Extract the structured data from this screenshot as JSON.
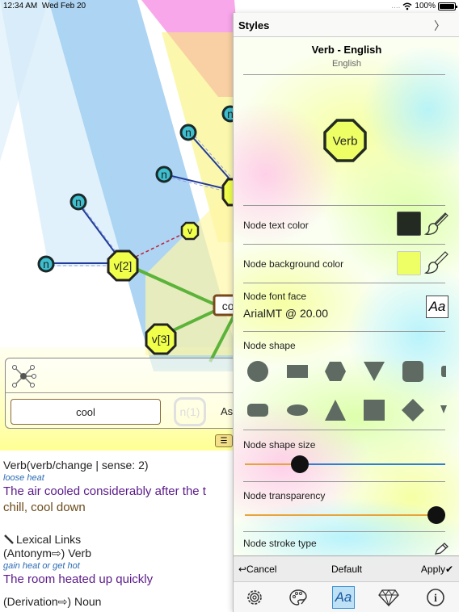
{
  "status_bar": {
    "time": "12:34 AM",
    "date": "Wed Feb 20",
    "signal": "....",
    "battery": "100%"
  },
  "graph": {
    "nodes": {
      "n_top": "n",
      "n_mid": "n",
      "n_left_upper": "n",
      "n_left": "n",
      "v_small": "v",
      "v2": "v[2]",
      "v3": "v[3]",
      "center": "coo"
    },
    "word_button": "cool",
    "ghost_node": "n(1)",
    "as_label": "As"
  },
  "text": {
    "sense_header": "Verb(verb/change | sense: 2)",
    "gloss1": "loose heat",
    "example1": "The air cooled considerably after the t",
    "synonyms1": "chill, cool down",
    "lexical_links": "Lexical Links",
    "relation1": "(Antonym⇨) Verb",
    "gloss2": "gain heat or get hot",
    "example2": "The room heated up quickly",
    "relation2": "(Derivation⇨) Noun"
  },
  "panel": {
    "header_title": "Styles",
    "close_glyph": "〉",
    "style_name": "Verb - English",
    "style_language": "English",
    "preview_label": "Verb",
    "node_text_color_label": "Node text color",
    "node_text_color": "#222a22",
    "node_bg_color_label": "Node background color",
    "node_bg_color": "#eeff66",
    "node_font_face_label": "Node font face",
    "node_font_face_value": "ArialMT @ 20.00",
    "aa_label": "Aa",
    "node_shape_label": "Node shape",
    "node_shape_size_label": "Node shape size",
    "node_shape_size_value": 0.25,
    "node_transparency_label": "Node transparency",
    "node_transparency_value": 1.0,
    "node_stroke_type_label": "Node stroke type",
    "bottom": {
      "cancel": "↩Cancel",
      "default": "Default",
      "apply": "Apply✔"
    },
    "tabs": [
      "gear-icon",
      "palette-icon",
      "font-icon",
      "diamond-icon",
      "info-icon"
    ],
    "active_tab": "font-icon",
    "tab_aa": "Aa",
    "tab_info": "i"
  }
}
